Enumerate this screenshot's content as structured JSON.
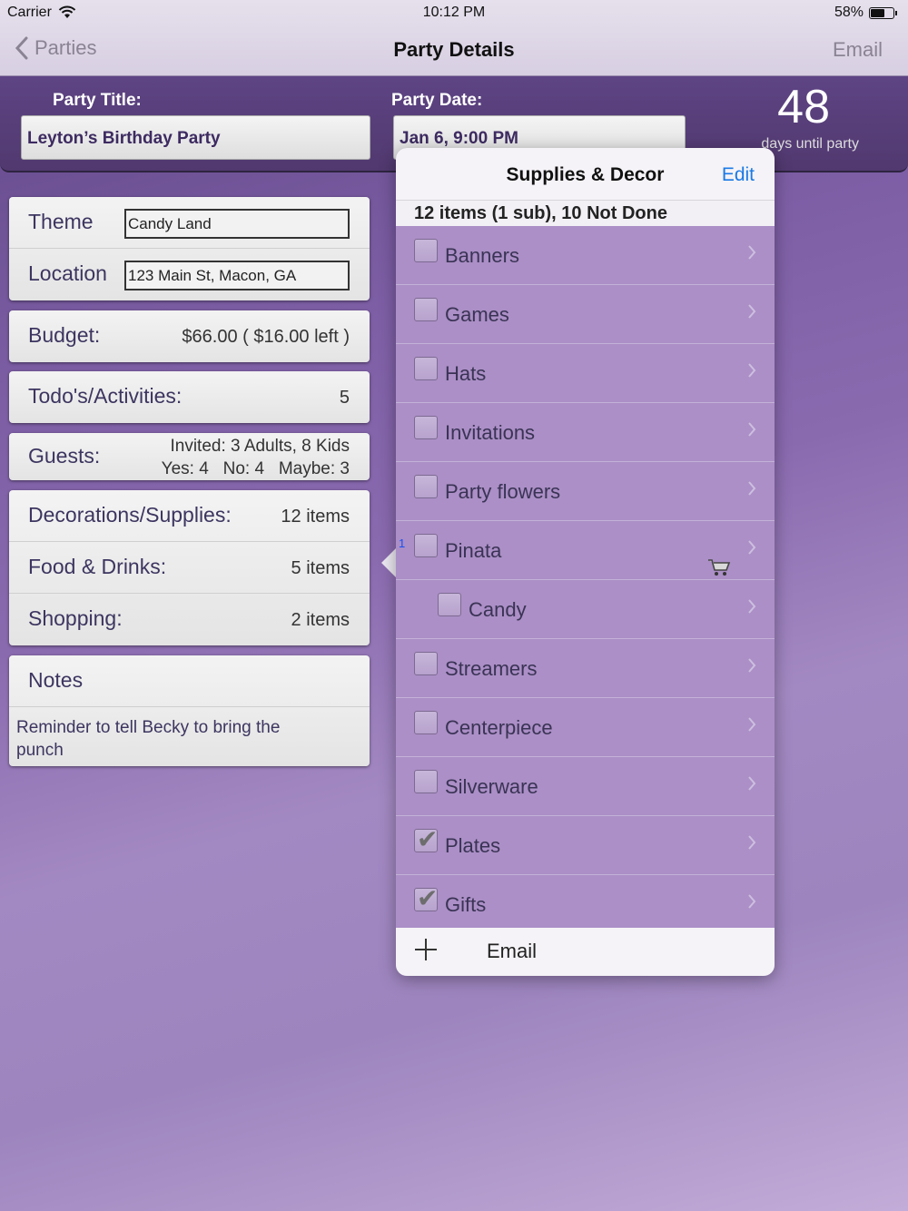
{
  "status": {
    "carrier": "Carrier",
    "time": "10:12 PM",
    "battery": "58%"
  },
  "nav": {
    "back": "Parties",
    "title": "Party Details",
    "right": "Email"
  },
  "header": {
    "title_label": "Party Title:",
    "title_value": "Leyton’s Birthday Party",
    "date_label": "Party Date:",
    "date_value": "Jan 6, 9:00 PM",
    "days_count": "48",
    "days_label": "days until party"
  },
  "details": {
    "theme_label": "Theme",
    "theme_value": "Candy Land",
    "location_label": "Location",
    "location_value": "123 Main St, Macon, GA",
    "budget_label": "Budget:",
    "budget_value": "$66.00 ( $16.00 left )",
    "todo_label": "Todo's/Activities:",
    "todo_value": "5",
    "guests_label": "Guests:",
    "guests_invited": "Invited: 3 Adults, 8 Kids",
    "guests_rsvp": "Yes: 4   No: 4   Maybe: 3",
    "decor_label": "Decorations/Supplies:",
    "decor_value": "12 items",
    "food_label": "Food & Drinks:",
    "food_value": "5 items",
    "shopping_label": "Shopping:",
    "shopping_value": "2 items",
    "notes_label": "Notes",
    "notes_text": "Reminder to tell Becky to bring the punch"
  },
  "popover": {
    "title": "Supplies & Decor",
    "edit": "Edit",
    "summary": "12 items (1 sub), 10 Not Done",
    "items": [
      {
        "label": "Banners",
        "checked": false,
        "sub": false
      },
      {
        "label": "Games",
        "checked": false,
        "sub": false
      },
      {
        "label": "Hats",
        "checked": false,
        "sub": false
      },
      {
        "label": "Invitations",
        "checked": false,
        "sub": false
      },
      {
        "label": "Party flowers",
        "checked": false,
        "sub": false
      },
      {
        "label": "Pinata",
        "checked": false,
        "sub": false,
        "badge": "1",
        "cart": true
      },
      {
        "label": "Candy",
        "checked": false,
        "sub": true
      },
      {
        "label": "Streamers",
        "checked": false,
        "sub": false
      },
      {
        "label": "Centerpiece",
        "checked": false,
        "sub": false
      },
      {
        "label": "Silverware",
        "checked": false,
        "sub": false
      },
      {
        "label": "Plates",
        "checked": true,
        "sub": false
      },
      {
        "label": "Gifts",
        "checked": true,
        "sub": false
      }
    ],
    "footer_email": "Email"
  }
}
